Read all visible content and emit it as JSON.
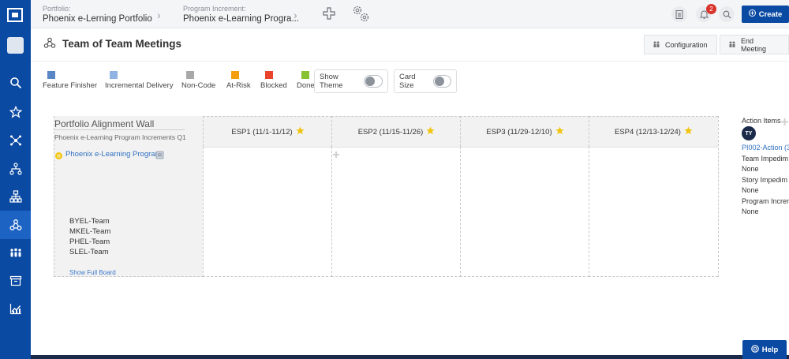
{
  "topbar": {
    "portfolio_label": "Portfolio:",
    "portfolio_value": "Phoenix e-Lerning Portfolio",
    "pi_label": "Program Increment:",
    "pi_value": "Phoenix e-Learning Progra...",
    "notification_count": "2",
    "create_label": "Create"
  },
  "header": {
    "title": "Team of Team Meetings",
    "configuration_label": "Configuration",
    "end_meeting_label": "End Meeting"
  },
  "legend": [
    {
      "label": "Feature Finisher",
      "color": "#5a86c5"
    },
    {
      "label": "Incremental Delivery",
      "color": "#8fb4e3"
    },
    {
      "label": "Non-Code",
      "color": "#a8a8a8"
    },
    {
      "label": "At-Risk",
      "color": "#f59e0b"
    },
    {
      "label": "Blocked",
      "color": "#e8452c"
    },
    {
      "label": "Done",
      "color": "#86c232"
    }
  ],
  "toggles": {
    "show_theme": "Show Theme",
    "card_size": "Card Size"
  },
  "wall": {
    "title": "Portfolio Alignment Wall",
    "subtitle": "Phoenix e-Learning Program Increments Q1",
    "program": "Phoenix e-Learning Program",
    "teams": [
      "BYEL-Team",
      "MKEL-Team",
      "PHEL-Team",
      "SLEL-Team"
    ],
    "show_full_board": "Show Full Board",
    "sprints": [
      "ESP1 (11/1-11/12)",
      "ESP2 (11/15-11/26)",
      "ESP3 (11/29-12/10)",
      "ESP4 (12/13-12/24)"
    ]
  },
  "action_items": {
    "title": "Action Items",
    "avatar": "TY",
    "link": "PI002-Action (3",
    "rows": [
      {
        "label": "Team Impedim",
        "value": "None"
      },
      {
        "label": "Story Impedim",
        "value": "None"
      },
      {
        "label": "Program Increr",
        "value": "None"
      }
    ]
  },
  "help_label": "Help",
  "colors": {
    "brand": "#0b4aa2",
    "sidebar_active": "#1d63c4",
    "link": "#2f6fc0"
  }
}
